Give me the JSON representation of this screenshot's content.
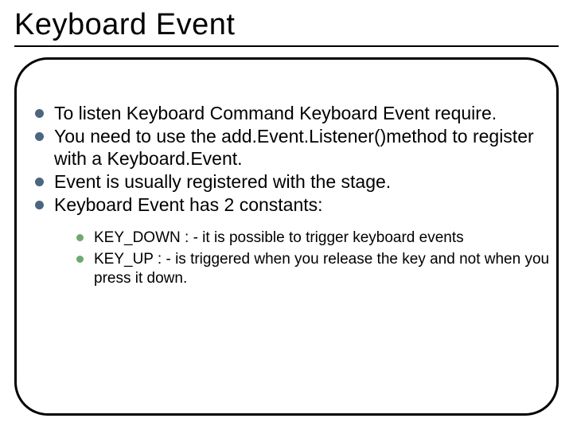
{
  "slide": {
    "title": "Keyboard Event",
    "bullets": [
      "To listen Keyboard Command Keyboard Event require.",
      "You need to use the  add.Event.Listener()method to register with a Keyboard.Event.",
      "Event is usually registered with the stage.",
      "Keyboard Event has 2 constants:"
    ],
    "sub_bullets": [
      "KEY_DOWN : - it is possible to trigger keyboard events",
      "KEY_UP : -  is triggered when you release the key and not when you press it down."
    ]
  }
}
